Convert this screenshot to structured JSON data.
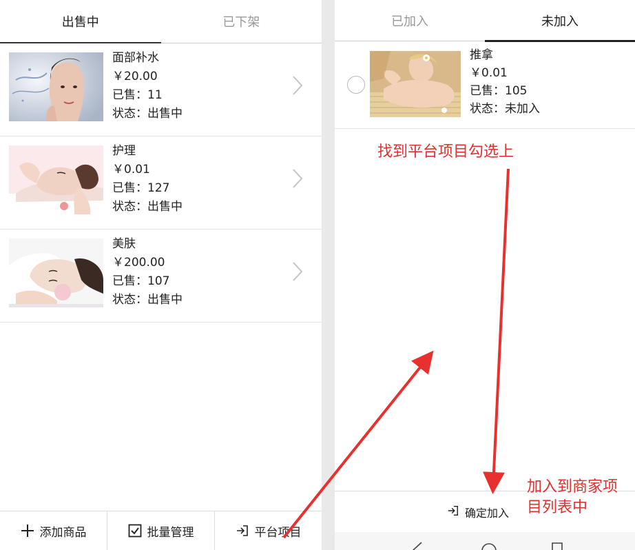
{
  "left": {
    "tabs": [
      {
        "label": "出售中",
        "active": true
      },
      {
        "label": "已下架",
        "active": false
      }
    ],
    "products": [
      {
        "name": "面部补水",
        "price": "￥20.00",
        "sold": "已售：11",
        "status": "状态：出售中"
      },
      {
        "name": "护理",
        "price": "￥0.01",
        "sold": "已售：127",
        "status": "状态：出售中"
      },
      {
        "name": "美肤",
        "price": "￥200.00",
        "sold": "已售：107",
        "status": "状态：出售中"
      }
    ],
    "footer": {
      "add_label": "添加商品",
      "batch_label": "批量管理",
      "platform_label": "平台项目"
    }
  },
  "right": {
    "tabs": [
      {
        "label": "已加入",
        "active": false
      },
      {
        "label": "未加入",
        "active": true
      }
    ],
    "item": {
      "name": "推拿",
      "price": "￥0.01",
      "sold": "已售：105",
      "status": "状态：未加入",
      "selected": false
    },
    "confirm_label": "确定加入"
  },
  "annotations": {
    "select_note": "找到平台项目勾选上",
    "add_note_line1": "加入到商家项",
    "add_note_line2": "目列表中",
    "color": "#e0302f"
  },
  "icons": [
    "plus-icon",
    "checkbox-icon",
    "login-icon",
    "chevron-right-icon",
    "radio-icon",
    "back-icon",
    "home-icon",
    "recents-icon"
  ]
}
